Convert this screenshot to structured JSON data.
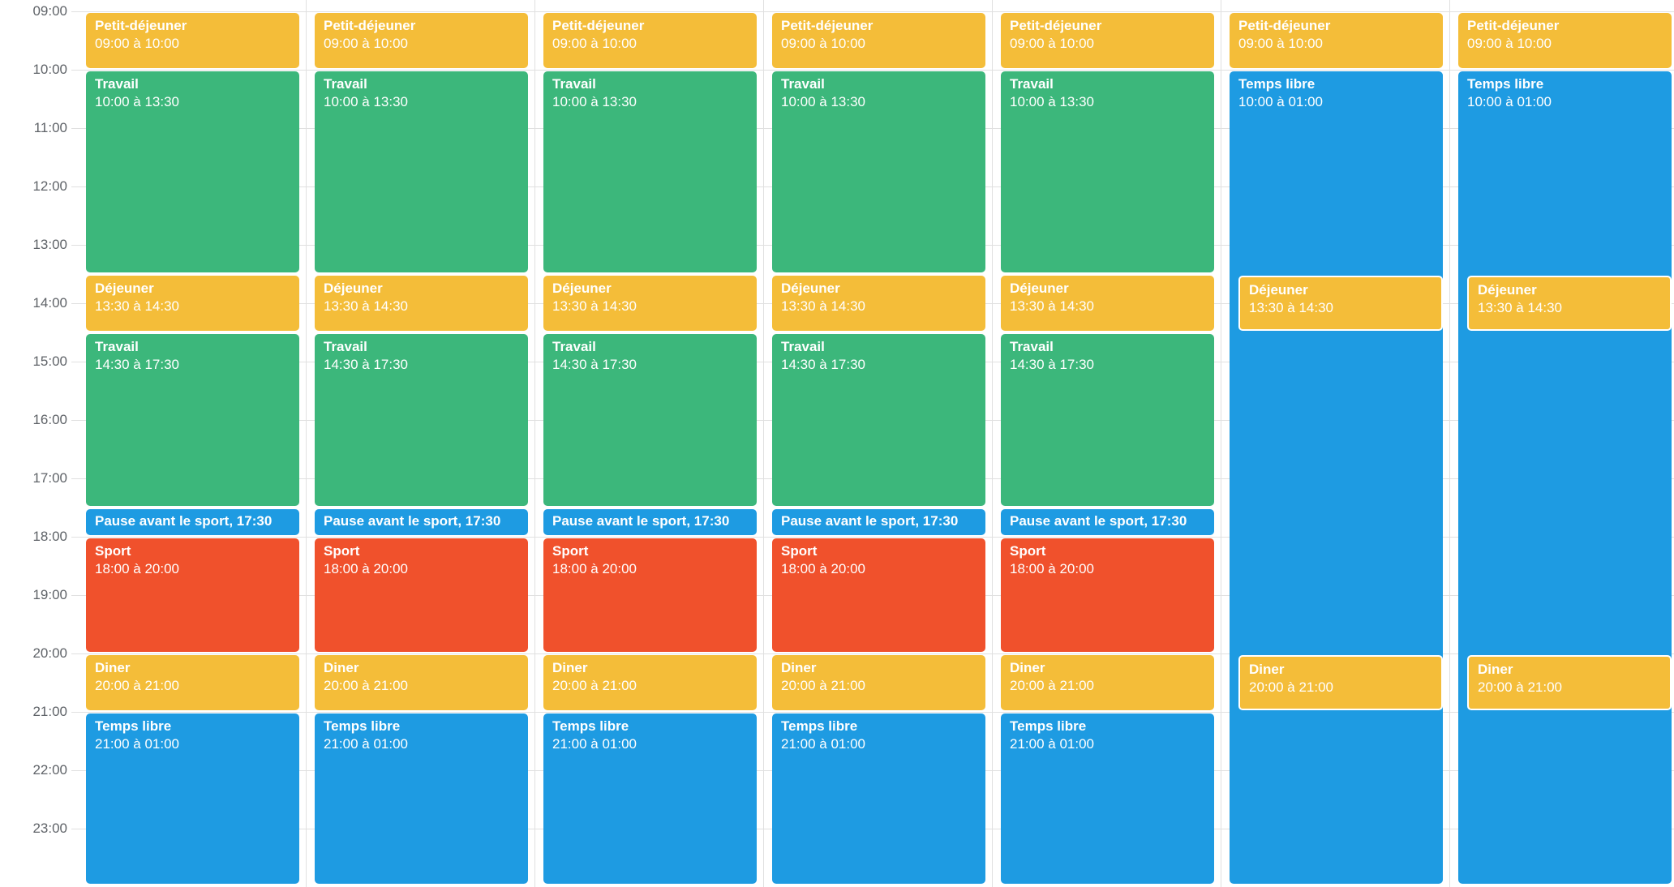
{
  "hours": [
    "09:00",
    "10:00",
    "11:00",
    "12:00",
    "13:00",
    "14:00",
    "15:00",
    "16:00",
    "17:00",
    "18:00",
    "19:00",
    "20:00",
    "21:00",
    "22:00",
    "23:00"
  ],
  "colors": {
    "meal": "#F4BD39",
    "work": "#3CB77B",
    "free": "#1E9BE2",
    "sport": "#F0512C",
    "pause": "#1E9BE2"
  },
  "days": [
    {
      "events": [
        {
          "type": "meal",
          "title": "Petit-déjeuner",
          "time": "09:00 à 10:00",
          "start": "09:00",
          "end": "10:00"
        },
        {
          "type": "work",
          "title": "Travail",
          "time": "10:00 à 13:30",
          "start": "10:00",
          "end": "13:30"
        },
        {
          "type": "meal",
          "title": "Déjeuner",
          "time": "13:30 à 14:30",
          "start": "13:30",
          "end": "14:30"
        },
        {
          "type": "work",
          "title": "Travail",
          "time": "14:30 à 17:30",
          "start": "14:30",
          "end": "17:30"
        },
        {
          "type": "pause",
          "title": "Pause avant le sport, 17:30",
          "time": "",
          "start": "17:30",
          "end": "18:00",
          "compact": true
        },
        {
          "type": "sport",
          "title": "Sport",
          "time": "18:00 à 20:00",
          "start": "18:00",
          "end": "20:00"
        },
        {
          "type": "meal",
          "title": "Diner",
          "time": "20:00 à 21:00",
          "start": "20:00",
          "end": "21:00"
        },
        {
          "type": "free",
          "title": "Temps libre",
          "time": "21:00 à 01:00",
          "start": "21:00",
          "end": "01:00"
        }
      ]
    },
    {
      "events": [
        {
          "type": "meal",
          "title": "Petit-déjeuner",
          "time": "09:00 à 10:00",
          "start": "09:00",
          "end": "10:00"
        },
        {
          "type": "work",
          "title": "Travail",
          "time": "10:00 à 13:30",
          "start": "10:00",
          "end": "13:30"
        },
        {
          "type": "meal",
          "title": "Déjeuner",
          "time": "13:30 à 14:30",
          "start": "13:30",
          "end": "14:30"
        },
        {
          "type": "work",
          "title": "Travail",
          "time": "14:30 à 17:30",
          "start": "14:30",
          "end": "17:30"
        },
        {
          "type": "pause",
          "title": "Pause avant le sport, 17:30",
          "time": "",
          "start": "17:30",
          "end": "18:00",
          "compact": true
        },
        {
          "type": "sport",
          "title": "Sport",
          "time": "18:00 à 20:00",
          "start": "18:00",
          "end": "20:00"
        },
        {
          "type": "meal",
          "title": "Diner",
          "time": "20:00 à 21:00",
          "start": "20:00",
          "end": "21:00"
        },
        {
          "type": "free",
          "title": "Temps libre",
          "time": "21:00 à 01:00",
          "start": "21:00",
          "end": "01:00"
        }
      ]
    },
    {
      "events": [
        {
          "type": "meal",
          "title": "Petit-déjeuner",
          "time": "09:00 à 10:00",
          "start": "09:00",
          "end": "10:00"
        },
        {
          "type": "work",
          "title": "Travail",
          "time": "10:00 à 13:30",
          "start": "10:00",
          "end": "13:30"
        },
        {
          "type": "meal",
          "title": "Déjeuner",
          "time": "13:30 à 14:30",
          "start": "13:30",
          "end": "14:30"
        },
        {
          "type": "work",
          "title": "Travail",
          "time": "14:30 à 17:30",
          "start": "14:30",
          "end": "17:30"
        },
        {
          "type": "pause",
          "title": "Pause avant le sport, 17:30",
          "time": "",
          "start": "17:30",
          "end": "18:00",
          "compact": true
        },
        {
          "type": "sport",
          "title": "Sport",
          "time": "18:00 à 20:00",
          "start": "18:00",
          "end": "20:00"
        },
        {
          "type": "meal",
          "title": "Diner",
          "time": "20:00 à 21:00",
          "start": "20:00",
          "end": "21:00"
        },
        {
          "type": "free",
          "title": "Temps libre",
          "time": "21:00 à 01:00",
          "start": "21:00",
          "end": "01:00"
        }
      ]
    },
    {
      "events": [
        {
          "type": "meal",
          "title": "Petit-déjeuner",
          "time": "09:00 à 10:00",
          "start": "09:00",
          "end": "10:00"
        },
        {
          "type": "work",
          "title": "Travail",
          "time": "10:00 à 13:30",
          "start": "10:00",
          "end": "13:30"
        },
        {
          "type": "meal",
          "title": "Déjeuner",
          "time": "13:30 à 14:30",
          "start": "13:30",
          "end": "14:30"
        },
        {
          "type": "work",
          "title": "Travail",
          "time": "14:30 à 17:30",
          "start": "14:30",
          "end": "17:30"
        },
        {
          "type": "pause",
          "title": "Pause avant le sport, 17:30",
          "time": "",
          "start": "17:30",
          "end": "18:00",
          "compact": true
        },
        {
          "type": "sport",
          "title": "Sport",
          "time": "18:00 à 20:00",
          "start": "18:00",
          "end": "20:00"
        },
        {
          "type": "meal",
          "title": "Diner",
          "time": "20:00 à 21:00",
          "start": "20:00",
          "end": "21:00"
        },
        {
          "type": "free",
          "title": "Temps libre",
          "time": "21:00 à 01:00",
          "start": "21:00",
          "end": "01:00"
        }
      ]
    },
    {
      "events": [
        {
          "type": "meal",
          "title": "Petit-déjeuner",
          "time": "09:00 à 10:00",
          "start": "09:00",
          "end": "10:00"
        },
        {
          "type": "work",
          "title": "Travail",
          "time": "10:00 à 13:30",
          "start": "10:00",
          "end": "13:30"
        },
        {
          "type": "meal",
          "title": "Déjeuner",
          "time": "13:30 à 14:30",
          "start": "13:30",
          "end": "14:30"
        },
        {
          "type": "work",
          "title": "Travail",
          "time": "14:30 à 17:30",
          "start": "14:30",
          "end": "17:30"
        },
        {
          "type": "pause",
          "title": "Pause avant le sport, 17:30",
          "time": "",
          "start": "17:30",
          "end": "18:00",
          "compact": true
        },
        {
          "type": "sport",
          "title": "Sport",
          "time": "18:00 à 20:00",
          "start": "18:00",
          "end": "20:00"
        },
        {
          "type": "meal",
          "title": "Diner",
          "time": "20:00 à 21:00",
          "start": "20:00",
          "end": "21:00"
        },
        {
          "type": "free",
          "title": "Temps libre",
          "time": "21:00 à 01:00",
          "start": "21:00",
          "end": "01:00"
        }
      ]
    },
    {
      "events": [
        {
          "type": "meal",
          "title": "Petit-déjeuner",
          "time": "09:00 à 10:00",
          "start": "09:00",
          "end": "10:00"
        },
        {
          "type": "free",
          "title": "Temps libre",
          "time": "10:00 à 01:00",
          "start": "10:00",
          "end": "01:00"
        },
        {
          "type": "meal",
          "title": "Déjeuner",
          "time": "13:30 à 14:30",
          "start": "13:30",
          "end": "14:30",
          "overlap": true
        },
        {
          "type": "meal",
          "title": "Diner",
          "time": "20:00 à 21:00",
          "start": "20:00",
          "end": "21:00",
          "overlap": true
        }
      ]
    },
    {
      "events": [
        {
          "type": "meal",
          "title": "Petit-déjeuner",
          "time": "09:00 à 10:00",
          "start": "09:00",
          "end": "10:00"
        },
        {
          "type": "free",
          "title": "Temps libre",
          "time": "10:00 à 01:00",
          "start": "10:00",
          "end": "01:00"
        },
        {
          "type": "meal",
          "title": "Déjeuner",
          "time": "13:30 à 14:30",
          "start": "13:30",
          "end": "14:30",
          "overlap": true
        },
        {
          "type": "meal",
          "title": "Diner",
          "time": "20:00 à 21:00",
          "start": "20:00",
          "end": "21:00",
          "overlap": true
        }
      ]
    }
  ]
}
